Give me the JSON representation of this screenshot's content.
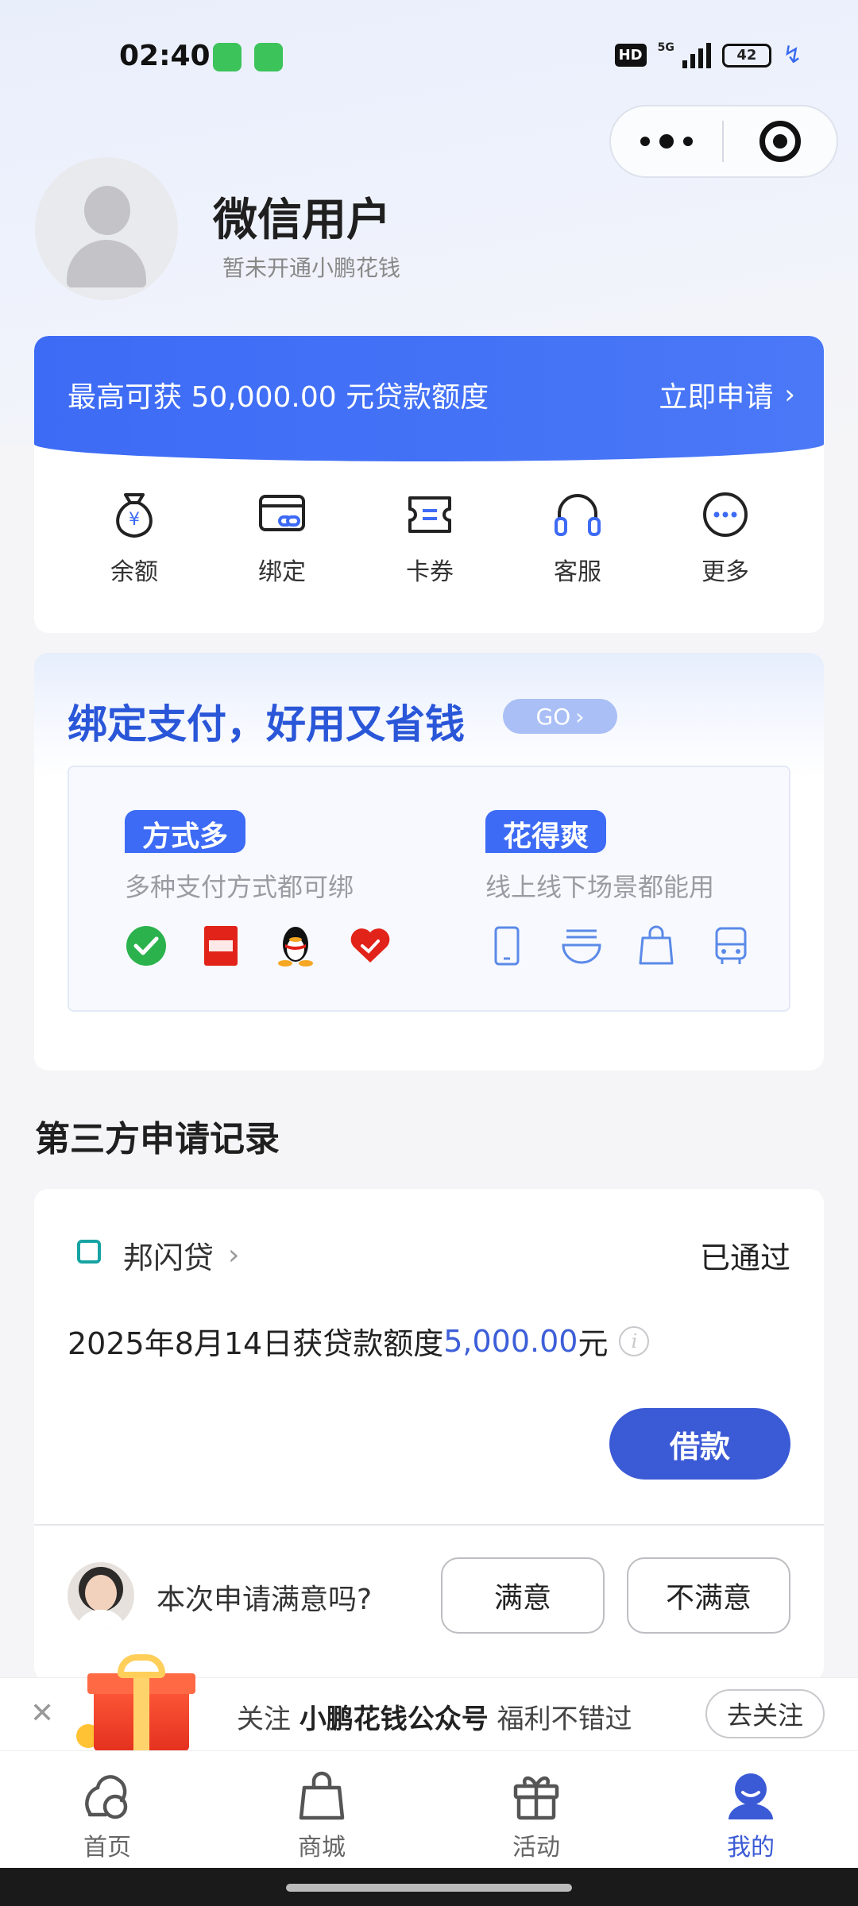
{
  "status_bar": {
    "time": "02:40",
    "hd": "HD",
    "network": "5G",
    "battery": "42"
  },
  "profile": {
    "name": "微信用户",
    "subtitle": "暂未开通小鹏花钱"
  },
  "quota": {
    "text": "最高可获  50,000.00  元贷款额度",
    "apply_label": "立即申请"
  },
  "shortcuts": [
    {
      "label": "余额",
      "icon": "money-bag-icon"
    },
    {
      "label": "绑定",
      "icon": "card-link-icon"
    },
    {
      "label": "卡券",
      "icon": "coupon-icon"
    },
    {
      "label": "客服",
      "icon": "headset-icon"
    },
    {
      "label": "更多",
      "icon": "more-icon"
    }
  ],
  "bind_promo": {
    "title": "绑定支付，好用又省钱",
    "go_label": "GO",
    "left": {
      "tag": "方式多",
      "desc": "多种支付方式都可绑",
      "icons": [
        "wechat-pay-icon",
        "jd-pay-icon",
        "qq-icon",
        "heart-pay-icon"
      ]
    },
    "right": {
      "tag": "花得爽",
      "desc": "线上线下场景都能用",
      "icons": [
        "phone-icon",
        "noodle-bowl-icon",
        "shopping-bag-icon",
        "bus-icon"
      ]
    }
  },
  "section_title": "第三方申请记录",
  "record": {
    "lender": "邦闪贷",
    "status": "已通过",
    "line_prefix": "2025年8月14日获贷款额度",
    "amount": "5,000.00",
    "unit": "元",
    "info": "i",
    "borrow_label": "借款",
    "satisfaction_question": "本次申请满意吗?",
    "satisfied_label": "满意",
    "unsatisfied_label": "不满意"
  },
  "follow_bar": {
    "prefix": "关注 ",
    "bold": "小鹏花钱公众号",
    "suffix": " 福利不错过",
    "button": "去关注"
  },
  "tabs": [
    {
      "label": "首页",
      "icon": "home-icon",
      "active": false
    },
    {
      "label": "商城",
      "icon": "shop-bag-icon",
      "active": false
    },
    {
      "label": "活动",
      "icon": "gift-icon",
      "active": false
    },
    {
      "label": "我的",
      "icon": "user-icon",
      "active": true
    }
  ],
  "colors": {
    "primary": "#3d6bf5",
    "button": "#3b5ad6",
    "amount": "#3d5fd8"
  }
}
